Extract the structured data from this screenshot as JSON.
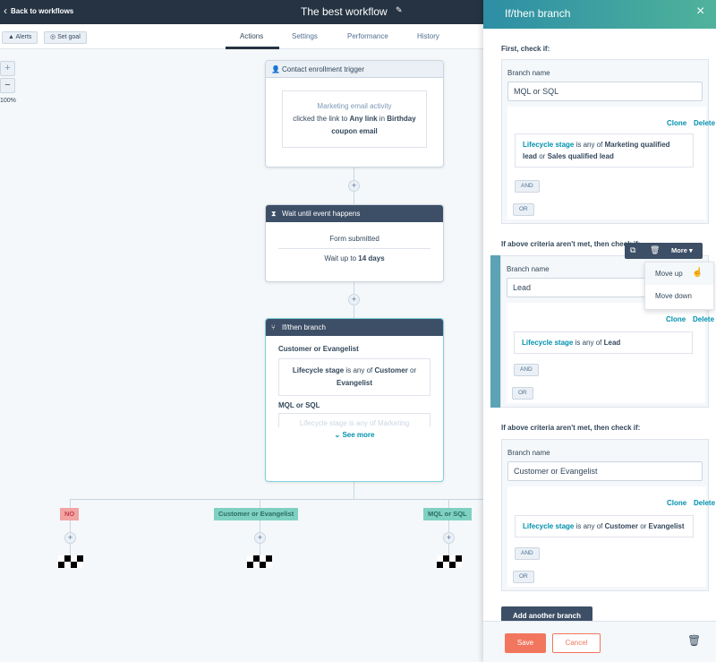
{
  "topbar": {
    "back": "Back to workflows",
    "title": "The best workflow"
  },
  "subbar": {
    "alerts": "Alerts",
    "set_goal": "Set goal",
    "tabs": [
      "Actions",
      "Settings",
      "Performance",
      "History"
    ],
    "active_tab": "Actions"
  },
  "zoom": {
    "in": "+",
    "out": "−",
    "level": "100%"
  },
  "nodes": {
    "trigger": {
      "title": "Contact enrollment trigger",
      "category": "Marketing email activity",
      "pre": "clicked the link to ",
      "link": "Any link",
      "mid": " in ",
      "email": "Birthday coupon email"
    },
    "wait": {
      "title": "Wait until event happens",
      "event": "Form submitted",
      "wait_pre": "Wait up to ",
      "wait_val": "14 days"
    },
    "branch": {
      "title": "If/then branch",
      "b1_name": "Customer or Evangelist",
      "b1_prop": "Lifecycle stage",
      "b1_op": " is any of ",
      "b1_v1": "Customer",
      "b1_or": " or ",
      "b1_v2": "Evangelist",
      "b2_name": "MQL or SQL",
      "b2_preview": "Lifecycle stage is any of Marketing",
      "see_more": "See more"
    }
  },
  "plus": "+",
  "branches": [
    {
      "label": "NO",
      "color": "#f2a3a3"
    },
    {
      "label": "Customer or Evangelist",
      "color": "#7fd1c2"
    },
    {
      "label": "MQL or SQL",
      "color": "#7fd1c2"
    }
  ],
  "panel": {
    "title": "If/then branch",
    "first": "First, check if:",
    "next": "If above criteria aren't met, then check if:",
    "branch_name_label": "Branch name",
    "clone": "Clone",
    "delete": "Delete",
    "and": "AND",
    "or": "OR",
    "cards": [
      {
        "name": "MQL or SQL",
        "prop": "Lifecycle stage",
        "op": " is any of ",
        "v1": "Marketing qualified lead",
        "conj": " or ",
        "v2": "Sales qualified lead"
      },
      {
        "name": "Lead",
        "prop": "Lifecycle stage",
        "op": " is any of ",
        "v1": "Lead"
      },
      {
        "name": "Customer or Evangelist",
        "prop": "Lifecycle stage",
        "op": " is any of ",
        "v1": "Customer",
        "conj": " or ",
        "v2": "Evangelist"
      }
    ],
    "toolbar": {
      "more": "More ▾"
    },
    "menu": [
      "Move up",
      "Move down"
    ],
    "add_branch": "Add another branch",
    "save": "Save",
    "cancel": "Cancel"
  },
  "colors": {
    "accent": "#0091ae",
    "save": "#f2765e",
    "dark": "#253342"
  }
}
